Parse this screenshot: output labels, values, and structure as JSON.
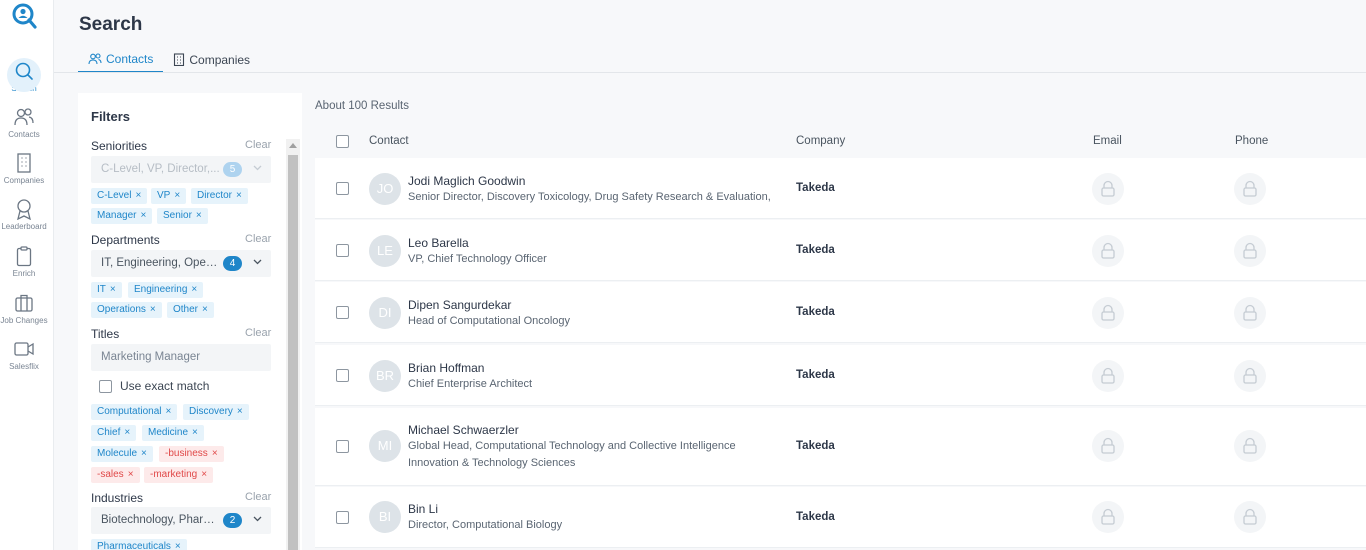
{
  "nav": {
    "items": [
      {
        "label": "Search",
        "icon": "search-icon",
        "active": true
      },
      {
        "label": "Contacts",
        "icon": "contacts-icon"
      },
      {
        "label": "Companies",
        "icon": "companies-icon"
      },
      {
        "label": "Leaderboard",
        "icon": "ribbon-icon"
      },
      {
        "label": "Enrich",
        "icon": "clipboard-icon"
      },
      {
        "label": "Job Changes",
        "icon": "briefcase-icon"
      },
      {
        "label": "Salesflix",
        "icon": "video-icon"
      }
    ]
  },
  "header": {
    "title": "Search",
    "tabs": [
      {
        "label": "Contacts",
        "icon": "users-icon",
        "active": true
      },
      {
        "label": "Companies",
        "icon": "building-icon"
      }
    ]
  },
  "filters": {
    "title": "Filters",
    "clear_label": "Clear",
    "seniorities": {
      "label": "Seniorities",
      "value": "C-Level, VP, Director,...",
      "count": "5",
      "chips": [
        "C-Level",
        "VP",
        "Director",
        "Manager",
        "Senior"
      ]
    },
    "departments": {
      "label": "Departments",
      "value": "IT, Engineering, Opera...",
      "count": "4",
      "chips": [
        "IT",
        "Engineering",
        "Operations",
        "Other"
      ]
    },
    "titles": {
      "label": "Titles",
      "placeholder": "Marketing Manager",
      "exact_match_label": "Use exact match",
      "chips": [
        "Computational",
        "Discovery",
        "Chief",
        "Medicine",
        "Molecule",
        "-business",
        "-sales",
        "-marketing"
      ]
    },
    "industries": {
      "label": "Industries",
      "value": "Biotechnology, Pharm...",
      "count": "2",
      "chips": [
        "Pharmaceuticals"
      ]
    },
    "chip_remove_symbol": "×"
  },
  "results": {
    "count_label": "About 100 Results",
    "columns": {
      "contact": "Contact",
      "company": "Company",
      "email": "Email",
      "phone": "Phone"
    },
    "rows": [
      {
        "initials": "JO",
        "name": "Jodi Maglich Goodwin",
        "title": "Senior Director, Discovery Toxicology, Drug Safety Research & Evaluation,",
        "company": "Takeda"
      },
      {
        "initials": "LE",
        "name": "Leo Barella",
        "title": "VP, Chief Technology Officer",
        "company": "Takeda"
      },
      {
        "initials": "DI",
        "name": "Dipen Sangurdekar",
        "title": "Head of Computational Oncology",
        "company": "Takeda"
      },
      {
        "initials": "BR",
        "name": "Brian Hoffman",
        "title": "Chief Enterprise Architect",
        "company": "Takeda"
      },
      {
        "initials": "MI",
        "name": "Michael Schwaerzler",
        "title": "Global Head, Computational Technology and Collective Intelligence Innovation & Technology Sciences",
        "company": "Takeda"
      },
      {
        "initials": "BI",
        "name": "Bin Li",
        "title": "Director, Computational Biology",
        "company": "Takeda"
      }
    ]
  },
  "colors": {
    "accent": "#1f86c9",
    "negative_chip": "#e04848"
  }
}
